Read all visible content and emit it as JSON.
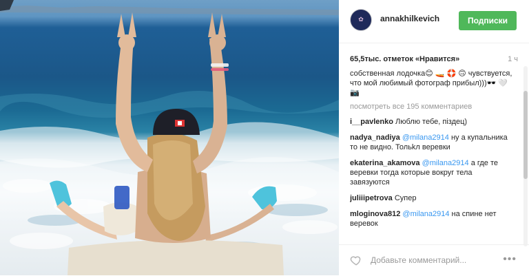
{
  "post": {
    "username": "annakhilkevich",
    "follow_label": "Подписки",
    "likes": "65,5тыс. отметок «Нравится»",
    "time": "1 ч",
    "caption": "собственная лодочка😊 🚤 🛟 🙃 чувствуется, что мой любимый фотограф прибыл)))🕶️ 🤍 📷",
    "view_all": "посмотреть все 195 комментариев",
    "comment_placeholder": "Добавьте комментарий...",
    "more": "•••"
  },
  "comments": [
    {
      "author": "i__pavlenko",
      "mention": "",
      "text": "Люблю тебе, піздец)"
    },
    {
      "author": "nadya_nadiya",
      "mention": "@milana2914",
      "text": "ну а купальника то не видно. Тольkл веревки"
    },
    {
      "author": "ekaterina_akamova",
      "mention": "@milana2914",
      "text": "а где те веревки тогда которые вокруг тела завязуются"
    },
    {
      "author": "juliiipetrova",
      "mention": "",
      "text": "Супер"
    },
    {
      "author": "mloginova812",
      "mention": "@milana2914",
      "text": "на спине нет веревок"
    }
  ],
  "icons": {
    "avatar": "avatar",
    "heart": "heart-outline-icon",
    "more": "more-dots-icon"
  }
}
